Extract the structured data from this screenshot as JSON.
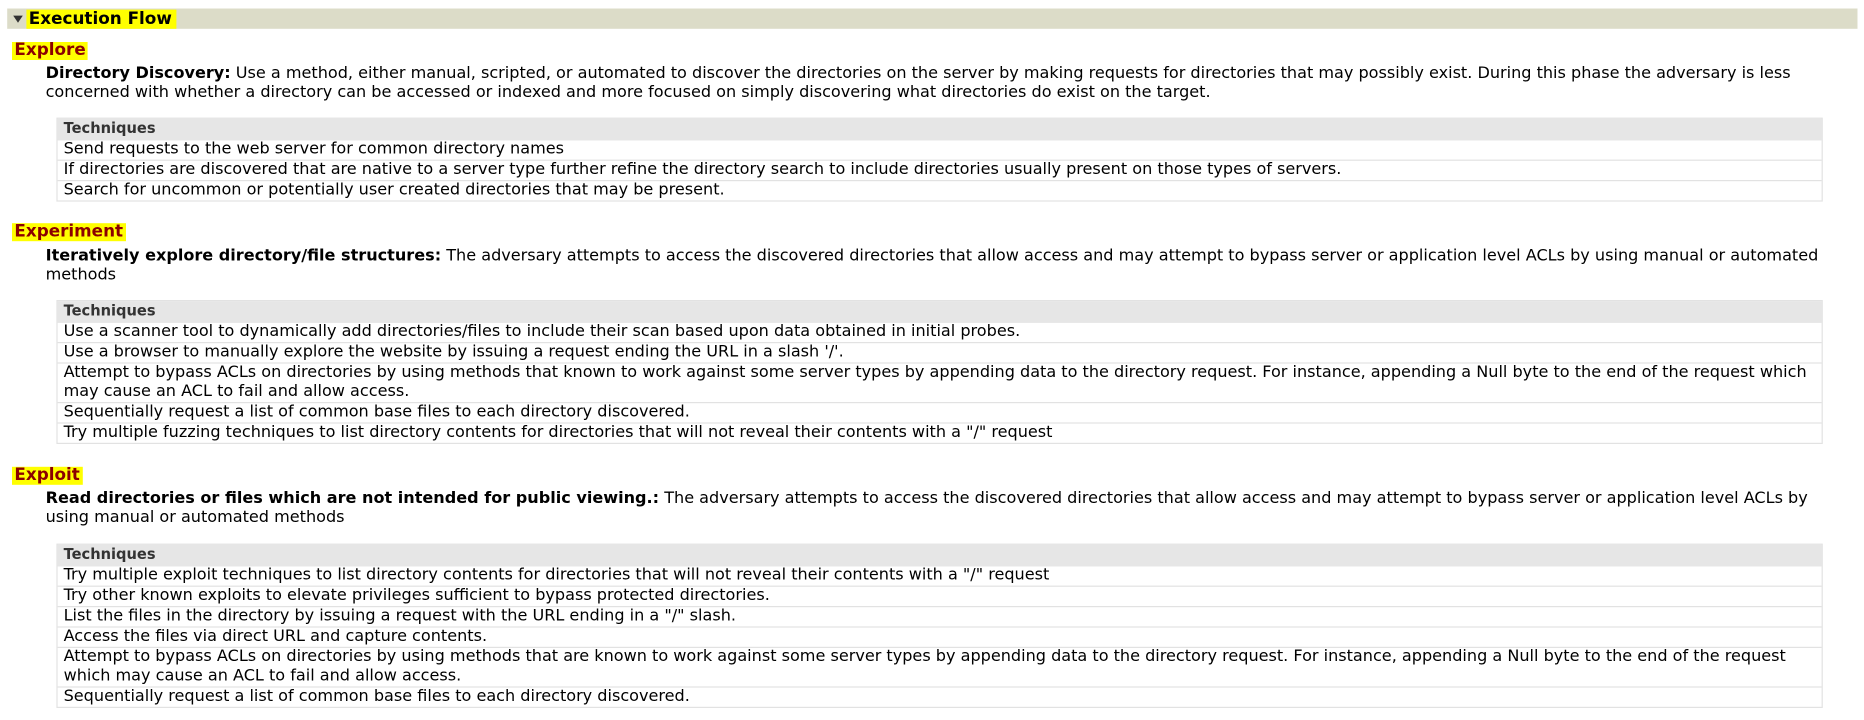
{
  "section": {
    "title": "Execution Flow",
    "toggle_icon": "triangle-down-icon"
  },
  "colors": {
    "highlight": "#ffff00",
    "phase_text": "#8b0000",
    "header_bar": "#dcdcc8",
    "table_header": "#e6e6e6"
  },
  "phases": [
    {
      "name": "Explore",
      "step_title": "Directory Discovery:",
      "step_text": " Use a method, either manual, scripted, or automated to discover the directories on the server by making requests for directories that may possibly exist. During this phase the adversary is less concerned with whether a directory can be accessed or indexed and more focused on simply discovering what directories do exist on the target.",
      "techniques_header": "Techniques",
      "techniques": [
        "Send requests to the web server for common directory names",
        "If directories are discovered that are native to a server type further refine the directory search to include directories usually present on those types of servers.",
        "Search for uncommon or potentially user created directories that may be present."
      ]
    },
    {
      "name": "Experiment",
      "step_title": "Iteratively explore directory/file structures:",
      "step_text": " The adversary attempts to access the discovered directories that allow access and may attempt to bypass server or application level ACLs by using manual or automated methods",
      "techniques_header": "Techniques",
      "techniques": [
        "Use a scanner tool to dynamically add directories/files to include their scan based upon data obtained in initial probes.",
        "Use a browser to manually explore the website by issuing a request ending the URL in a slash '/'.",
        "Attempt to bypass ACLs on directories by using methods that known to work against some server types by appending data to the directory request. For instance, appending a Null byte to the end of the request which may cause an ACL to fail and allow access.",
        "Sequentially request a list of common base files to each directory discovered.",
        "Try multiple fuzzing techniques to list directory contents for directories that will not reveal their contents with a \"/\" request"
      ]
    },
    {
      "name": "Exploit",
      "step_title": "Read directories or files which are not intended for public viewing.:",
      "step_text": " The adversary attempts to access the discovered directories that allow access and may attempt to bypass server or application level ACLs by using manual or automated methods",
      "techniques_header": "Techniques",
      "techniques": [
        "Try multiple exploit techniques to list directory contents for directories that will not reveal their contents with a \"/\" request",
        "Try other known exploits to elevate privileges sufficient to bypass protected directories.",
        "List the files in the directory by issuing a request with the URL ending in a \"/\" slash.",
        "Access the files via direct URL and capture contents.",
        "Attempt to bypass ACLs on directories by using methods that are known to work against some server types by appending data to the directory request. For instance, appending a Null byte to the end of the request which may cause an ACL to fail and allow access.",
        "Sequentially request a list of common base files to each directory discovered."
      ]
    }
  ]
}
